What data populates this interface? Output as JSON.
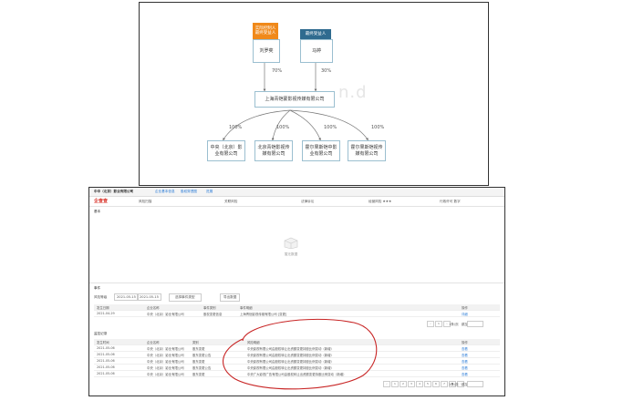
{
  "diagram": {
    "controller": {
      "tag": "实际控制人\n最终受益人",
      "name": "刘罗奕"
    },
    "beneficiary": {
      "tag": "最终受益人",
      "name": "马婷"
    },
    "pct_left": "70%",
    "pct_right": "30%",
    "company": "上海青铠蒙影视传媒有限公司",
    "subs": [
      {
        "pct": "100%",
        "name": "中央（北京）影\n业有限公司"
      },
      {
        "pct": "100%",
        "name": "北京青铠影视传\n媒有限公司"
      },
      {
        "pct": "100%",
        "name": "霍尔果斯铠中影\n业有限公司"
      },
      {
        "pct": "100%",
        "name": "霍尔果斯铠视传\n媒有限公司"
      }
    ],
    "watermark": "n.d"
  },
  "app": {
    "title": "中中（北京）影业有限公司",
    "tabs": [
      "企业基本信息",
      "股权穿透图",
      "进展"
    ],
    "brand": "企查查",
    "stats": [
      "风险扫描",
      "关联风险",
      "法律诉讼",
      "经营风险 ★★★",
      "行政许可 数字"
    ],
    "section1": "基本",
    "empty_text": "暂无数据",
    "section2": "事件",
    "filter": {
      "label": "风险等级",
      "date_from": "2021-05-15",
      "date_to": "2021-05-15",
      "select": "选择事件类型",
      "export": "导出数据"
    },
    "table1": {
      "headers": [
        "发生日期",
        "企业名称",
        "事件类别",
        "事件明细",
        "操作"
      ],
      "rows": [
        [
          "2021-04-29",
          "中央（北京）影业有限公司",
          "股权变更信息",
          "上海青铠影视传媒有限公司 [变更]",
          "详细"
        ]
      ]
    },
    "page_info": "1条/页",
    "jump": "跳至",
    "section3": "监控记录",
    "table2": {
      "headers": [
        "发生时间",
        "企业名称",
        "类别",
        "风险明细",
        "操作"
      ],
      "rows": [
        [
          "2021-05-06",
          "中央（北京）影业有限公司",
          "股东变更",
          "中央影视有限公司由股权转让出资额变更持股比例变动（新增）",
          "查看"
        ],
        [
          "2021-05-06",
          "中央（北京）影业有限公司",
          "股东变更公告",
          "中央影视有限公司由股权转让出资额变更持股比例变动（新增）",
          "查看"
        ],
        [
          "2021-05-06",
          "中央（北京）影业有限公司",
          "股东变更",
          "中央影视有限公司由股权转让出资额变更持股比例变动（新增）",
          "查看"
        ],
        [
          "2021-05-06",
          "中央（北京）影业有限公司",
          "股东变更公告",
          "中央影视有限公司由股权转让出资额变更持股比例变动（新增）",
          "查看"
        ],
        [
          "2021-05-06",
          "中央（北京）影业有限公司",
          "股东变更",
          "中央广大影视广告有限公司由股权转让出资额变更持股比例变动（新增）",
          "查看"
        ]
      ]
    },
    "pager_pages": [
      "1",
      "2",
      "3",
      "4",
      "5",
      "6",
      "7",
      "8"
    ]
  }
}
